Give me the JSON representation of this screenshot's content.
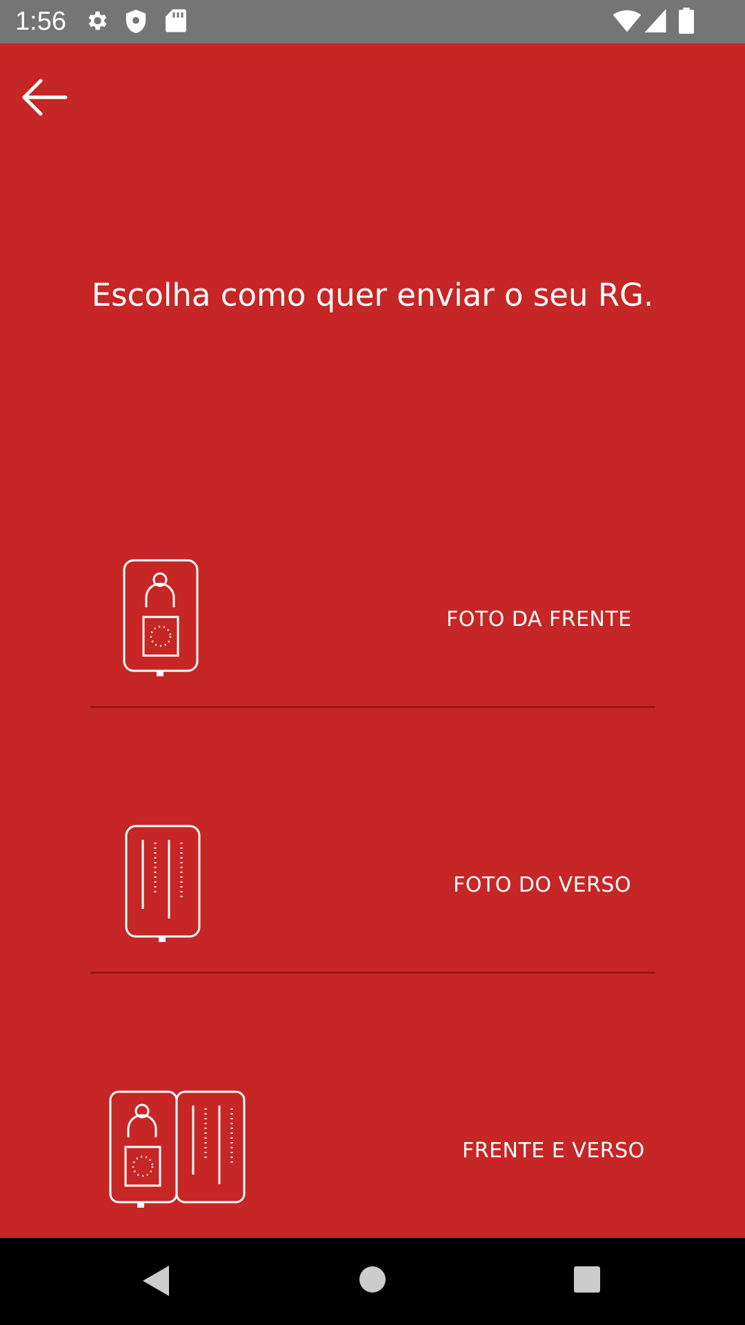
{
  "status_bar": {
    "time": "1:56",
    "left_icons": [
      "gear-icon",
      "shield-icon",
      "sd-card-icon"
    ],
    "right_icons": [
      "wifi-icon",
      "cell-signal-icon",
      "battery-icon"
    ]
  },
  "header": {
    "back_icon": "arrow-left-icon"
  },
  "title": "Escolha como quer enviar o seu RG.",
  "options": [
    {
      "label": "FOTO DA FRENTE",
      "icon": "id-front-icon"
    },
    {
      "label": "FOTO DO VERSO",
      "icon": "id-back-icon"
    },
    {
      "label": "FRENTE E VERSO",
      "icon": "id-front-back-icon"
    }
  ],
  "nav_bar": {
    "buttons": [
      "nav-back-icon",
      "nav-home-icon",
      "nav-recents-icon"
    ]
  },
  "colors": {
    "background": "#c62625",
    "divider": "#9a1716",
    "status_bar": "#757575",
    "nav_bar": "#000000",
    "foreground": "#ffffff"
  }
}
